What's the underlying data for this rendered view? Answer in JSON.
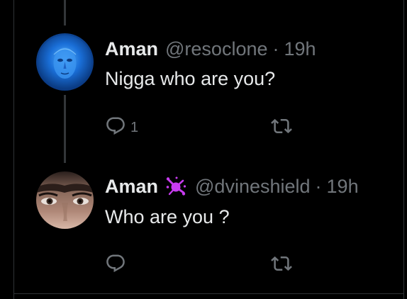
{
  "colors": {
    "background": "#000000",
    "text_primary": "#e7e9ea",
    "text_secondary": "#71767b",
    "badge": "#c83cf0"
  },
  "tweets": [
    {
      "name": "Aman",
      "handle": "@resoclone",
      "separator": "·",
      "time": "19h",
      "text": "Nigga who are you?",
      "reply_count": "1",
      "avatar": "blue-mask-avatar",
      "reply_icon": "reply-icon",
      "retweet_icon": "retweet-icon"
    },
    {
      "name": "Aman",
      "badge_icon": "purple-splat-badge-icon",
      "handle": "@dvineshield",
      "separator": "·",
      "time": "19h",
      "text": "Who are you ?",
      "reply_count": "",
      "avatar": "eyes-closeup-avatar",
      "reply_icon": "reply-icon",
      "retweet_icon": "retweet-icon"
    }
  ]
}
